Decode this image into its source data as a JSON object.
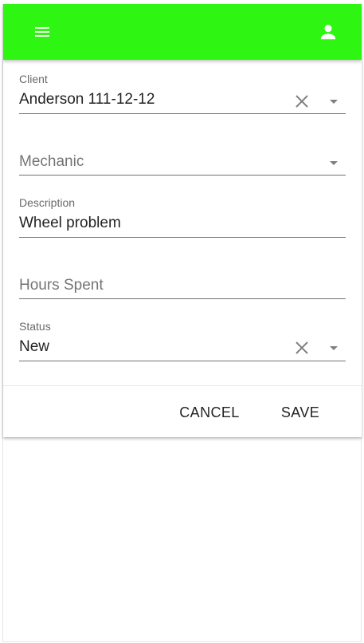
{
  "colors": {
    "appbar": "#2ef512",
    "icon": "#ffffff"
  },
  "appbar": {
    "menu_icon": "menu-icon",
    "account_icon": "account-icon"
  },
  "form": {
    "client": {
      "label": "Client",
      "value": "Anderson 111-12-12"
    },
    "mechanic": {
      "placeholder": "Mechanic",
      "value": ""
    },
    "description": {
      "label": "Description",
      "value": "Wheel problem"
    },
    "hours": {
      "placeholder": "Hours Spent",
      "value": ""
    },
    "status": {
      "label": "Status",
      "value": "New"
    }
  },
  "actions": {
    "cancel_label": "Cancel",
    "save_label": "Save"
  }
}
